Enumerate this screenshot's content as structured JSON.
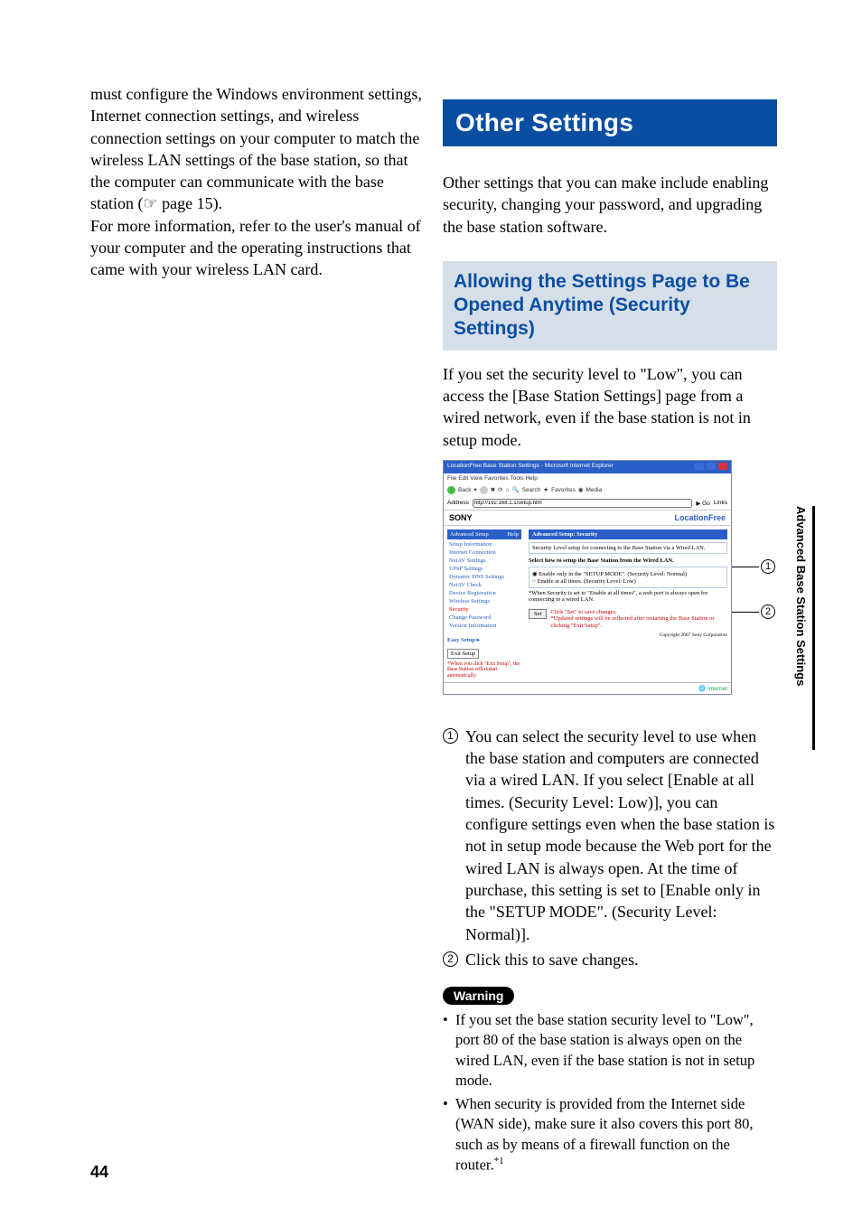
{
  "page_number": "44",
  "side_tab": "Advanced Base Station Settings",
  "left_col": {
    "para": "must configure the Windows environment settings, Internet connection settings, and wireless connection settings on your computer to match the wireless LAN settings of the base station, so that the computer can communicate with the base station (☞ page 15).\nFor more information, refer to the user's manual of your computer and the operating instructions that came with your wireless LAN card."
  },
  "right_col": {
    "title": "Other Settings",
    "intro": "Other settings that you can make include enabling security, changing your password, and upgrading the base station software.",
    "subhead": "Allowing the Settings Page to Be Opened Anytime (Security Settings)",
    "para1": "If you set the security level to \"Low\", you can access the [Base Station Settings] page from a wired network, even if the base station is not in setup mode.",
    "list": {
      "item1": "You can select the security level to use when the base station and computers are connected via a wired LAN. If you select [Enable at all times. (Security Level: Low)], you can configure settings even when the base station is not in setup mode because the Web port for the wired LAN is always open. At the time of purchase, this setting is set to [Enable only in the \"SETUP MODE\". (Security Level: Normal)].",
      "item2": "Click this to save changes."
    },
    "warning_label": "Warning",
    "warnings": [
      "If you set the base station security level to \"Low\", port 80 of the base station is always open on the wired LAN, even if the base station is not in setup mode.",
      "When security is provided from the Internet side (WAN side), make sure it also covers this port 80, such as by means of a firewall function on the router."
    ],
    "footnote_ref": "*1"
  },
  "screenshot": {
    "window_title": "LocationFree Base Station Settings - Microsoft Internet Explorer",
    "menubar": "File  Edit  View  Favorites  Tools  Help",
    "toolbar": {
      "back": "Back",
      "search": "Search",
      "favorites": "Favorites",
      "media": "Media"
    },
    "address_label": "Address",
    "address_value": "http://192.168.1.1/setup.htm",
    "go": "Go",
    "links": "Links",
    "brand": "SONY",
    "product": "LocationFree",
    "sidebar": {
      "header": "Advanced Setup",
      "help": "Help",
      "items": [
        "Setup Information",
        "Internet Connection",
        "NetAV Settings",
        "UPnP Settings",
        "Dynamic DNS Settings",
        "NetAV Check",
        "Device Registration",
        "Wireless Settings",
        "Security",
        "Change Password",
        "Version Information"
      ],
      "easy": "Easy Setup ▸",
      "exit_btn": "Exit Setup",
      "exit_note": "*When you click \"Exit Setup\", the Base Station will restart automatically."
    },
    "main": {
      "heading": "Advanced Setup: Security",
      "desc": "Security Level setup for connecting to the Base Station via a Wired LAN.",
      "prompt": "Select how to setup the Base Station from the Wired LAN.",
      "opt1": "Enable only in the \"SETUP MODE\". (Security Level: Normal)",
      "opt2": "Enable at all times. (Security Level: Low)",
      "note": "*When Security is set to \"Enable at all times\", a web port is always open for connecting to a wired LAN.",
      "set_btn": "Set",
      "set_note1": "Click \"Set\" to save changes.",
      "set_note2": "*Updated settings will be reflected after restarting the Base Station or clicking \"Exit Setup\".",
      "copyright": "Copyright 2007 Sony Corporation"
    },
    "status": "Internet"
  },
  "callouts": {
    "c1": "1",
    "c2": "2"
  }
}
